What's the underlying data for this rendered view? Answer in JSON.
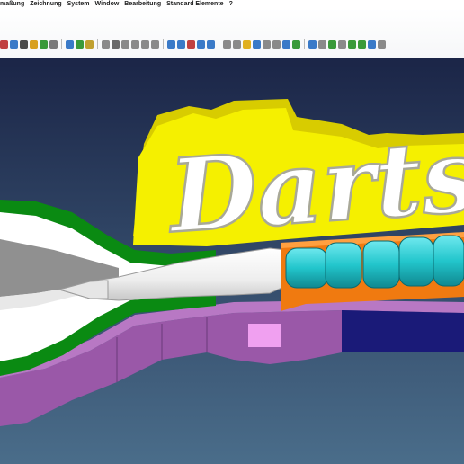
{
  "menu": {
    "items": [
      "maßung",
      "Zeichnung",
      "System",
      "Window",
      "Bearbeitung",
      "Standard Elemente",
      "?"
    ]
  },
  "toolbar": {
    "icons": [
      {
        "name": "hand-icon",
        "color": "#c04040"
      },
      {
        "name": "rotate-icon",
        "color": "#3a7ac8"
      },
      {
        "name": "zoom-icon",
        "color": "#4a4a4a"
      },
      {
        "name": "color-wheel-icon",
        "color": "#d8a020"
      },
      {
        "name": "shade-icon",
        "color": "#3a9a3a"
      },
      {
        "name": "render-icon",
        "color": "#7a7a7a"
      },
      {
        "name": "pan-icon",
        "color": "#3a7ac8"
      },
      {
        "name": "select-icon",
        "color": "#3a9a3a"
      },
      {
        "name": "fit-icon",
        "color": "#c0a030"
      },
      {
        "name": "cube-icon",
        "color": "#8a8a8a"
      },
      {
        "name": "box-icon",
        "color": "#6a6a6a"
      },
      {
        "name": "cylinder-icon",
        "color": "#8a8a8a"
      },
      {
        "name": "cone-icon",
        "color": "#8a8a8a"
      },
      {
        "name": "sphere-icon",
        "color": "#8a8a8a"
      },
      {
        "name": "torus-icon",
        "color": "#8a8a8a"
      },
      {
        "name": "move-icon",
        "color": "#3a7ac8"
      },
      {
        "name": "copy-icon",
        "color": "#3a7ac8"
      },
      {
        "name": "mirror-icon",
        "color": "#c04040"
      },
      {
        "name": "boolean-icon",
        "color": "#3a7ac8"
      },
      {
        "name": "cut-icon",
        "color": "#3a7ac8"
      },
      {
        "name": "layer-icon",
        "color": "#8a8a8a"
      },
      {
        "name": "group-icon",
        "color": "#8a8a8a"
      },
      {
        "name": "highlight-icon",
        "color": "#e0b020"
      },
      {
        "name": "properties-icon",
        "color": "#3a7ac8"
      },
      {
        "name": "list-icon",
        "color": "#8a8a8a"
      },
      {
        "name": "grid-icon",
        "color": "#8a8a8a"
      },
      {
        "name": "image-icon",
        "color": "#3a7ac8"
      },
      {
        "name": "globe-icon",
        "color": "#3a9a3a"
      },
      {
        "name": "arrow-icon",
        "color": "#3a7ac8"
      },
      {
        "name": "align-icon",
        "color": "#8a8a8a"
      },
      {
        "name": "snap-icon",
        "color": "#3a9a3a"
      },
      {
        "name": "measure-icon",
        "color": "#8a8a8a"
      },
      {
        "name": "pen-icon",
        "color": "#3a9a3a"
      },
      {
        "name": "check-icon",
        "color": "#3a9a3a"
      },
      {
        "name": "tag-icon",
        "color": "#3a7ac8"
      },
      {
        "name": "settings-icon",
        "color": "#8a8a8a"
      }
    ]
  },
  "viewport": {
    "background_top": "#1b2547",
    "background_bottom": "#4a6d8a",
    "sign_text": "Darts",
    "colors": {
      "sign_plate": "#f5f000",
      "sign_plate_side": "#d8cc00",
      "letters": "#ffffff",
      "letters_outline": "#b0b0a0",
      "frame_green": "#0a8a12",
      "base_purple": "#9a58a8",
      "pink": "#f0a0f0",
      "dart_barrel": "#22c6cc",
      "dart_holder": "#f07a10",
      "navy": "#1a1a78",
      "dart_white": "#f4f4f4",
      "gray": "#909090"
    }
  }
}
